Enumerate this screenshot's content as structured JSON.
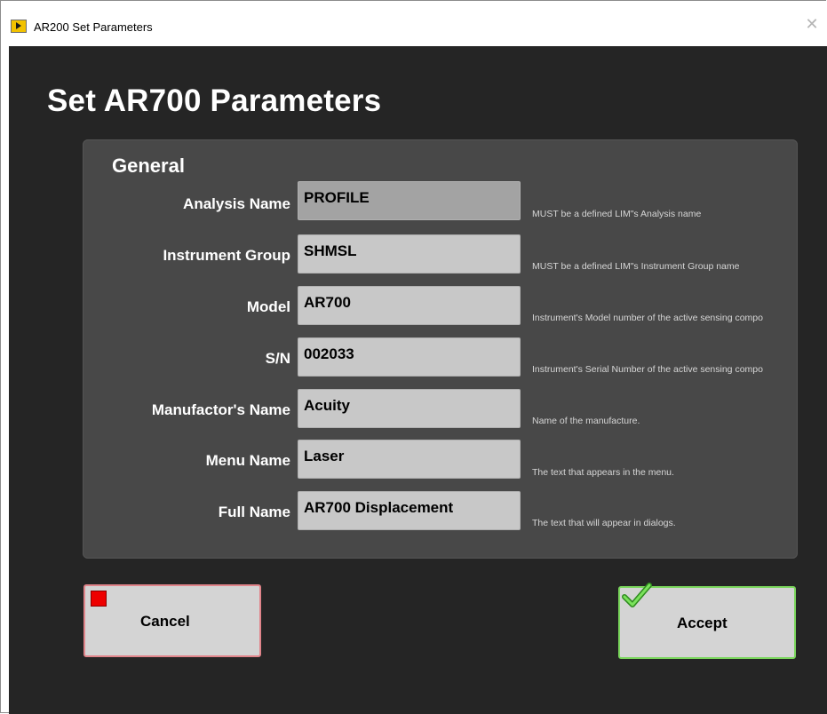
{
  "window": {
    "title": "AR200 Set Parameters",
    "close_glyph": "✕"
  },
  "page": {
    "title": "Set AR700 Parameters"
  },
  "panel": {
    "section": "General",
    "rows": [
      {
        "label": "Analysis Name",
        "value": "PROFILE",
        "hint": "MUST be a defined LIM\"s Analysis name"
      },
      {
        "label": "Instrument Group",
        "value": "SHMSL",
        "hint": "MUST be a defined LIM\"s Instrument Group name"
      },
      {
        "label": "Model",
        "value": "AR700",
        "hint": "Instrument's Model number of the active sensing compo"
      },
      {
        "label": "S/N",
        "value": "002033",
        "hint": "Instrument's Serial Number of the active sensing compo"
      },
      {
        "label": "Manufactor's Name",
        "value": "Acuity",
        "hint": "Name of the manufacture."
      },
      {
        "label": "Menu Name",
        "value": "Laser",
        "hint": "The text that appears in the menu."
      },
      {
        "label": "Full Name",
        "value": "AR700 Displacement",
        "hint": "The text that will appear in dialogs."
      }
    ]
  },
  "buttons": {
    "cancel": {
      "label": "Cancel",
      "icon": "stop-icon",
      "color": "#ee0000"
    },
    "accept": {
      "label": "Accept",
      "icon": "check-icon",
      "color": "#3fbf2a"
    }
  },
  "colors": {
    "background": "#252525",
    "panel": "#484848",
    "field": "#c8c8c8",
    "field_disabled": "#a3a3a3"
  }
}
